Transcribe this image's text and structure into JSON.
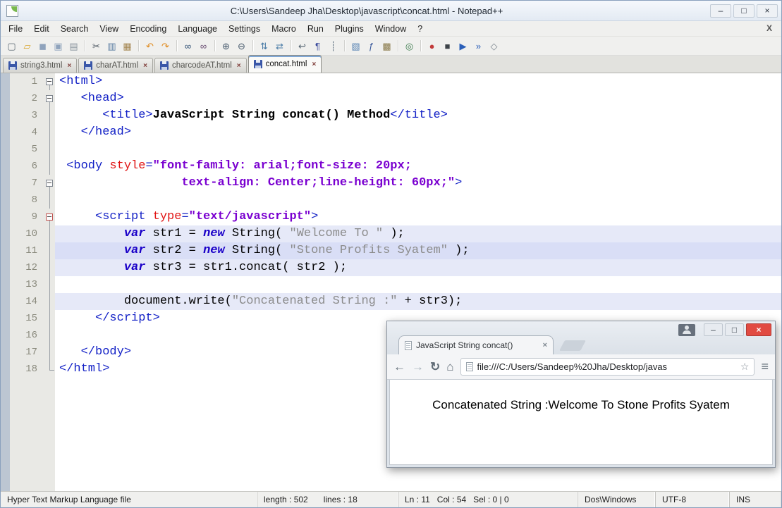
{
  "window": {
    "title": "C:\\Users\\Sandeep Jha\\Desktop\\javascript\\concat.html - Notepad++"
  },
  "icons": {
    "minimize": "–",
    "maximize": "□",
    "close": "×",
    "menu_close": "X",
    "tab_close": "×",
    "back": "←",
    "forward": "→",
    "reload": "↻",
    "home": "⌂",
    "star": "☆",
    "menu": "≡"
  },
  "menu_bar": {
    "items": [
      "File",
      "Edit",
      "Search",
      "View",
      "Encoding",
      "Language",
      "Settings",
      "Macro",
      "Run",
      "Plugins",
      "Window",
      "?"
    ]
  },
  "toolbar": {
    "icons": [
      {
        "name": "new-file-icon",
        "glyph": "▢",
        "color": "#5f6b76"
      },
      {
        "name": "open-folder-icon",
        "glyph": "▱",
        "color": "#d9a62e"
      },
      {
        "name": "save-icon",
        "glyph": "◼",
        "color": "#8fa3bc"
      },
      {
        "name": "save-all-icon",
        "glyph": "▣",
        "color": "#8fa3bc"
      },
      {
        "name": "print-icon",
        "glyph": "▤",
        "color": "#8a949e"
      },
      {
        "sep": true
      },
      {
        "name": "cut-icon",
        "glyph": "✂",
        "color": "#4a555f"
      },
      {
        "name": "copy-icon",
        "glyph": "▥",
        "color": "#5d7fa3"
      },
      {
        "name": "paste-icon",
        "glyph": "▦",
        "color": "#a3854f"
      },
      {
        "sep": true
      },
      {
        "name": "undo-icon",
        "glyph": "↶",
        "color": "#e08a1e"
      },
      {
        "name": "redo-icon",
        "glyph": "↷",
        "color": "#e08a1e"
      },
      {
        "sep": true
      },
      {
        "name": "find-icon",
        "glyph": "∞",
        "color": "#2f4f73"
      },
      {
        "name": "replace-icon",
        "glyph": "∞",
        "color": "#6b4f73"
      },
      {
        "sep": true
      },
      {
        "name": "zoom-in-icon",
        "glyph": "⊕",
        "color": "#44576b"
      },
      {
        "name": "zoom-out-icon",
        "glyph": "⊖",
        "color": "#44576b"
      },
      {
        "sep": true
      },
      {
        "name": "sync-vertical-icon",
        "glyph": "⇅",
        "color": "#4a7ba6"
      },
      {
        "name": "sync-horizontal-icon",
        "glyph": "⇄",
        "color": "#4a7ba6"
      },
      {
        "sep": true
      },
      {
        "name": "word-wrap-icon",
        "glyph": "↩",
        "color": "#51606e"
      },
      {
        "name": "show-all-characters-icon",
        "glyph": "¶",
        "color": "#3a4a9c"
      },
      {
        "name": "indent-guide-icon",
        "glyph": "┊",
        "color": "#5a6b7c"
      },
      {
        "sep": true
      },
      {
        "name": "document-map-icon",
        "glyph": "▧",
        "color": "#5b86b5"
      },
      {
        "name": "function-list-icon",
        "glyph": "ƒ",
        "color": "#3a5a9c"
      },
      {
        "name": "folder-as-workspace-icon",
        "glyph": "▩",
        "color": "#8a7a4a"
      },
      {
        "sep": true
      },
      {
        "name": "monitoring-icon",
        "glyph": "◎",
        "color": "#3a7a4a"
      },
      {
        "sep": true
      },
      {
        "name": "record-macro-icon",
        "glyph": "●",
        "color": "#c23b3b"
      },
      {
        "name": "stop-recording-icon",
        "glyph": "■",
        "color": "#3d4248"
      },
      {
        "name": "play-macro-icon",
        "glyph": "▶",
        "color": "#2b5fb8"
      },
      {
        "name": "run-macro-multiple-icon",
        "glyph": "»",
        "color": "#2b5fb8"
      },
      {
        "name": "save-macro-icon",
        "glyph": "◇",
        "color": "#7c868f"
      }
    ]
  },
  "tab_bar": {
    "tabs": [
      {
        "label": "string3.html",
        "active": false
      },
      {
        "label": "charAT.html",
        "active": false
      },
      {
        "label": "charcodeAT.html",
        "active": false
      },
      {
        "label": "concat.html",
        "active": true
      }
    ]
  },
  "editor": {
    "lines": [
      {
        "n": "1",
        "f": "box",
        "tok": [
          [
            "t",
            "<html>"
          ]
        ]
      },
      {
        "n": "2",
        "f": "box",
        "tok": [
          [
            "p",
            "   "
          ],
          [
            "t",
            "<head>"
          ]
        ]
      },
      {
        "n": "3",
        "f": "v",
        "tok": [
          [
            "p",
            "      "
          ],
          [
            "t",
            "<title>"
          ],
          [
            "b",
            "JavaScript String concat() Method"
          ],
          [
            "t",
            "</title>"
          ]
        ]
      },
      {
        "n": "4",
        "f": "v",
        "tok": [
          [
            "p",
            "   "
          ],
          [
            "t",
            "</head>"
          ]
        ]
      },
      {
        "n": "5",
        "f": "v",
        "tok": []
      },
      {
        "n": "6",
        "f": "v",
        "tok": [
          [
            "p",
            " "
          ],
          [
            "t",
            "<body"
          ],
          [
            "p",
            " "
          ],
          [
            "a",
            "style"
          ],
          [
            "t",
            "="
          ],
          [
            "v",
            "\"font-family: arial;font-size: 20px;"
          ]
        ]
      },
      {
        "n": "7",
        "f": "box",
        "tok": [
          [
            "p",
            "                 "
          ],
          [
            "v",
            "text-align: Center;line-height: 60px;\""
          ],
          [
            "t",
            ">"
          ]
        ]
      },
      {
        "n": "8",
        "f": "v",
        "tok": []
      },
      {
        "n": "9",
        "f": "boxr",
        "tok": [
          [
            "p",
            "     "
          ],
          [
            "t",
            "<script"
          ],
          [
            "p",
            " "
          ],
          [
            "a",
            "type"
          ],
          [
            "t",
            "="
          ],
          [
            "v",
            "\"text/javascript\""
          ],
          [
            "t",
            ">"
          ]
        ]
      },
      {
        "n": "10",
        "f": "v",
        "h": 1,
        "tok": [
          [
            "p",
            "         "
          ],
          [
            "k",
            "var"
          ],
          [
            "p",
            " str1 = "
          ],
          [
            "k",
            "new"
          ],
          [
            "p",
            " String( "
          ],
          [
            "s",
            "\"Welcome To \""
          ],
          [
            "p",
            " );"
          ]
        ]
      },
      {
        "n": "11",
        "f": "v",
        "h": 2,
        "tok": [
          [
            "p",
            "         "
          ],
          [
            "k",
            "var"
          ],
          [
            "p",
            " str2 = "
          ],
          [
            "k",
            "new"
          ],
          [
            "p",
            " String( "
          ],
          [
            "s",
            "\"Stone Profits Syatem\""
          ],
          [
            "p",
            " );"
          ]
        ]
      },
      {
        "n": "12",
        "f": "v",
        "h": 1,
        "tok": [
          [
            "p",
            "         "
          ],
          [
            "k",
            "var"
          ],
          [
            "p",
            " str3 = str1.concat( str2 );"
          ]
        ]
      },
      {
        "n": "13",
        "f": "v",
        "tok": []
      },
      {
        "n": "14",
        "f": "v",
        "h": 1,
        "tok": [
          [
            "p",
            "         document.write("
          ],
          [
            "s",
            "\"Concatenated String :\""
          ],
          [
            "p",
            " + str3);"
          ]
        ]
      },
      {
        "n": "15",
        "f": "v",
        "tok": [
          [
            "p",
            "     "
          ],
          [
            "t",
            "</script>"
          ]
        ]
      },
      {
        "n": "16",
        "f": "v",
        "tok": []
      },
      {
        "n": "17",
        "f": "v",
        "tok": [
          [
            "p",
            "   "
          ],
          [
            "t",
            "</body>"
          ]
        ]
      },
      {
        "n": "18",
        "f": "e",
        "tok": [
          [
            "t",
            "</html>"
          ]
        ]
      }
    ]
  },
  "browser_window": {
    "tab_title": "JavaScript String concat()",
    "url": "file:///C:/Users/Sandeep%20Jha/Desktop/javas",
    "content": "Concatenated String :Welcome To Stone Profits Syatem"
  },
  "status_bar": {
    "doc_type": "Hyper Text Markup Language file",
    "length": "length : 502",
    "lines": "lines : 18",
    "position": "Ln : 11   Col : 54   Sel : 0 | 0",
    "eol": "Dos\\Windows",
    "encoding": "UTF-8",
    "mode": "INS"
  }
}
